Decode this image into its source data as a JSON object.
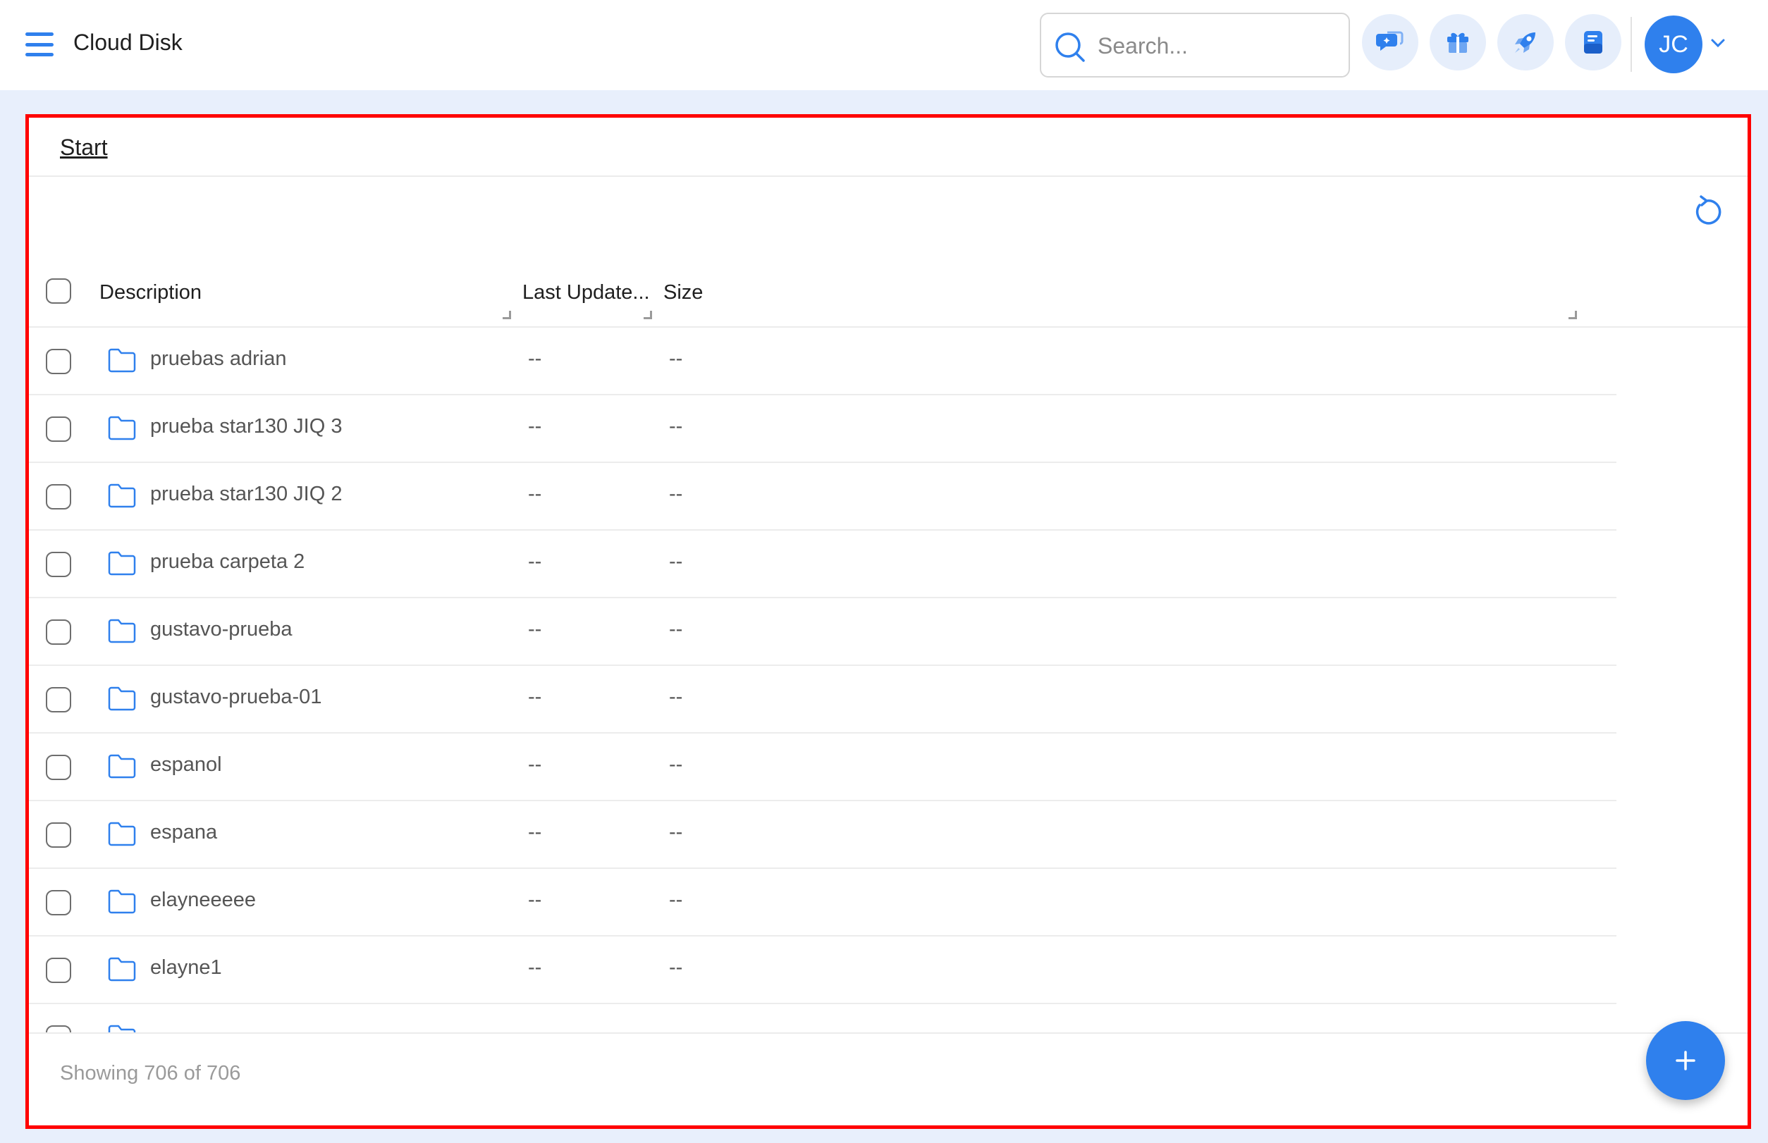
{
  "header": {
    "app_title": "Cloud Disk",
    "search_placeholder": "Search...",
    "avatar_initials": "JC",
    "actions": [
      "chat-sparkle-icon",
      "gift-icon",
      "rocket-icon",
      "notes-icon"
    ]
  },
  "breadcrumb": {
    "root": "Start"
  },
  "table": {
    "columns": [
      "Description",
      "Last Update...",
      "Size"
    ],
    "rows": [
      {
        "name": "pruebas adrian",
        "last_update": "--",
        "size": "--"
      },
      {
        "name": "prueba star130 JIQ 3",
        "last_update": "--",
        "size": "--"
      },
      {
        "name": "prueba star130 JIQ 2",
        "last_update": "--",
        "size": "--"
      },
      {
        "name": "prueba carpeta 2",
        "last_update": "--",
        "size": "--"
      },
      {
        "name": "gustavo-prueba",
        "last_update": "--",
        "size": "--"
      },
      {
        "name": "gustavo-prueba-01",
        "last_update": "--",
        "size": "--"
      },
      {
        "name": "espanol",
        "last_update": "--",
        "size": "--"
      },
      {
        "name": "espana",
        "last_update": "--",
        "size": "--"
      },
      {
        "name": "elayneeeee",
        "last_update": "--",
        "size": "--"
      },
      {
        "name": "elayne1",
        "last_update": "--",
        "size": "--"
      },
      {
        "name": "",
        "last_update": "",
        "size": ""
      }
    ]
  },
  "footer": {
    "status": "Showing 706 of 706"
  },
  "colors": {
    "accent": "#2f80ed",
    "highlight_border": "#ff0000",
    "background": "#e8effc"
  }
}
